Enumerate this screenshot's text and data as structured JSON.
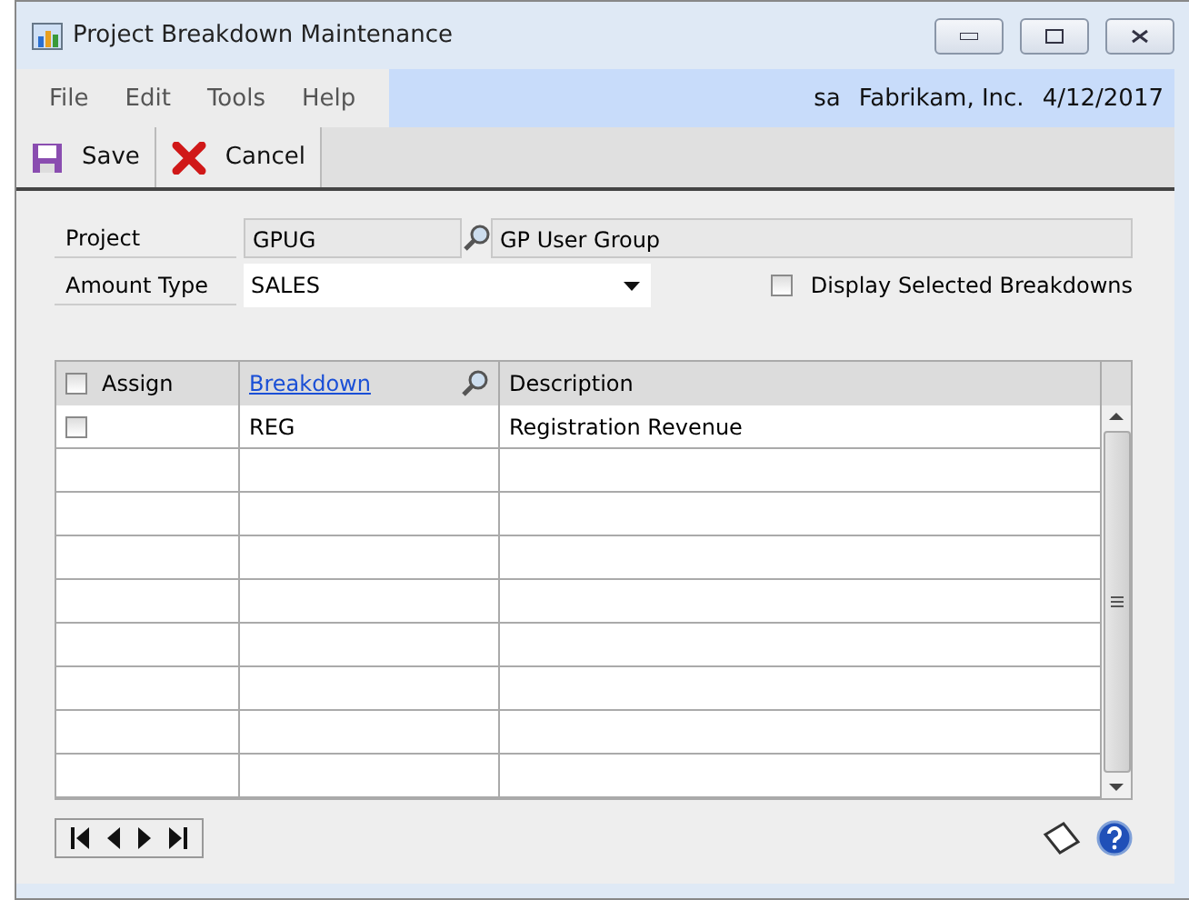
{
  "window": {
    "title": "Project Breakdown Maintenance"
  },
  "menu": [
    "File",
    "Edit",
    "Tools",
    "Help"
  ],
  "session": {
    "user": "sa",
    "company": "Fabrikam, Inc.",
    "date": "4/12/2017"
  },
  "toolbar": [
    {
      "kind": "save",
      "label": "Save"
    },
    {
      "kind": "cancel",
      "label": "Cancel"
    }
  ],
  "project": {
    "label": "Project",
    "id": "GPUG",
    "name": "GP User Group"
  },
  "amount_type": {
    "label": "Amount Type",
    "value": "SALES"
  },
  "display_selected": {
    "label": "Display Selected Breakdowns",
    "checked": false
  },
  "grid": {
    "assign_all": {
      "label": "Assign",
      "checked": false
    },
    "columns": [
      "Breakdown",
      "Description"
    ],
    "rows": [
      {
        "assigned": false,
        "breakdown": "REG",
        "description": "Registration Revenue"
      }
    ]
  }
}
